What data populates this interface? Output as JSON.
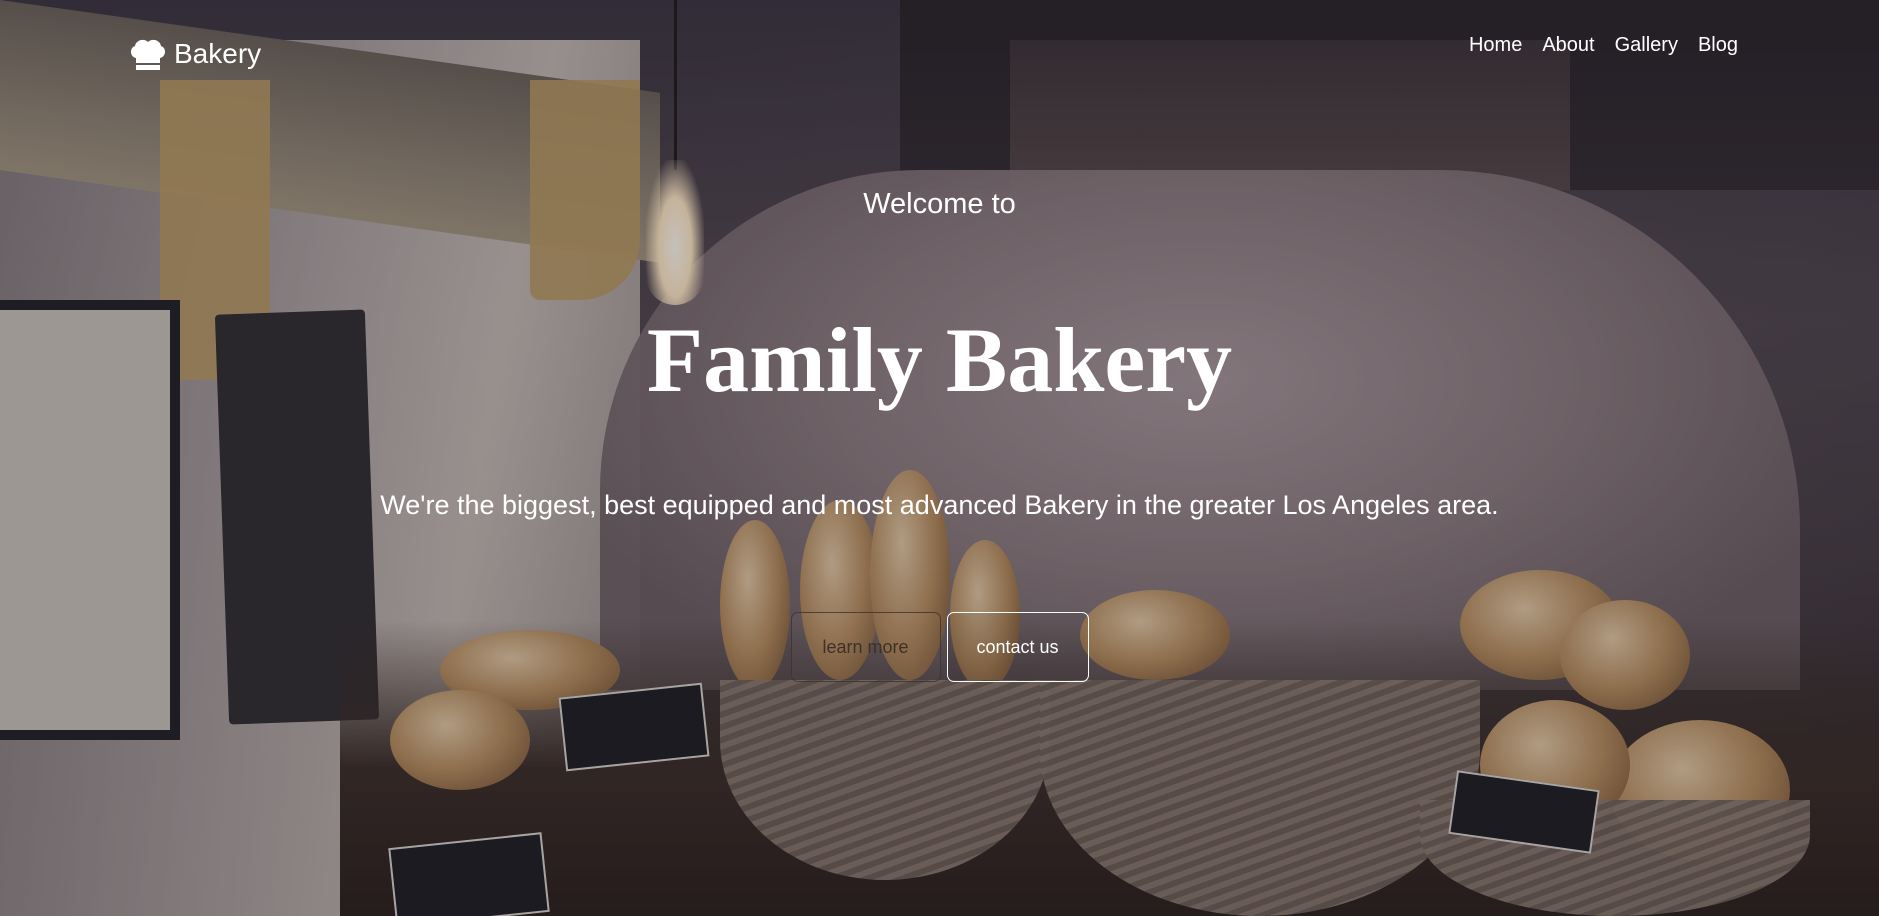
{
  "brand": {
    "name": "Bakery",
    "icon": "chef-hat-icon"
  },
  "nav": {
    "items": [
      {
        "label": "Home"
      },
      {
        "label": "About"
      },
      {
        "label": "Gallery"
      },
      {
        "label": "Blog"
      }
    ]
  },
  "hero": {
    "welcome": "Welcome to",
    "title": "Family Bakery",
    "tagline": "We're the biggest, best equipped and most advanced Bakery in the greater Los Angeles area.",
    "learn_more_label": "learn more",
    "contact_label": "contact us"
  },
  "colors": {
    "text": "#ffffff",
    "learn_more_text": "#3d3129"
  }
}
